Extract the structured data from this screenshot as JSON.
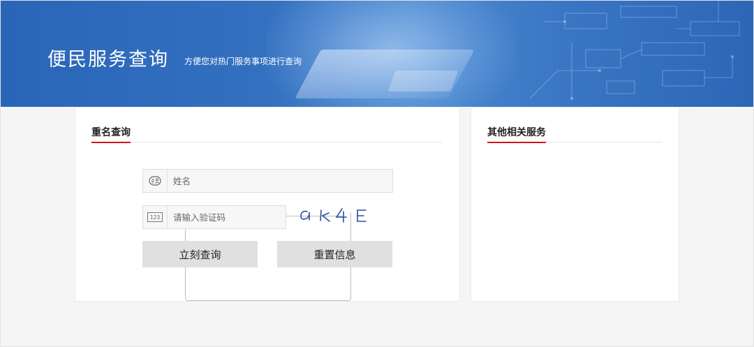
{
  "banner": {
    "title": "便民服务查询",
    "subtitle": "方便您对热门服务事项进行查询"
  },
  "main_section": {
    "title": "重名查询",
    "name_field": {
      "placeholder": "姓名",
      "value": "",
      "icon": "id-card-icon"
    },
    "code_field": {
      "placeholder": "请输入验证码",
      "value": "",
      "icon": "numeric-123-icon"
    },
    "captcha_text": "aK4E",
    "query_button": "立刻查询",
    "reset_button": "重置信息"
  },
  "side_section": {
    "title": "其他相关服务"
  },
  "colors": {
    "banner_blue": "#2f6cbd",
    "accent_red": "#d4141b",
    "button_gray": "#e0e0e0",
    "captcha_ink": "#2a4fa0"
  }
}
